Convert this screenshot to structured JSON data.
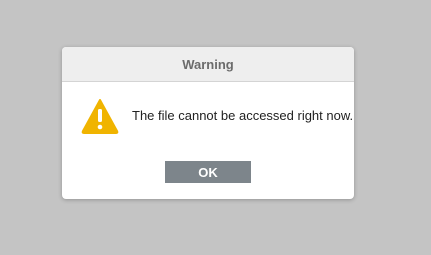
{
  "dialog": {
    "title": "Warning",
    "message": "The file cannot be accessed right now.",
    "ok_label": "OK",
    "icon": "warning-icon"
  },
  "colors": {
    "backdrop": "#c4c4c4",
    "header_bg": "#eeeeee",
    "icon_fill": "#f0b400",
    "button_bg": "#7d858b"
  }
}
